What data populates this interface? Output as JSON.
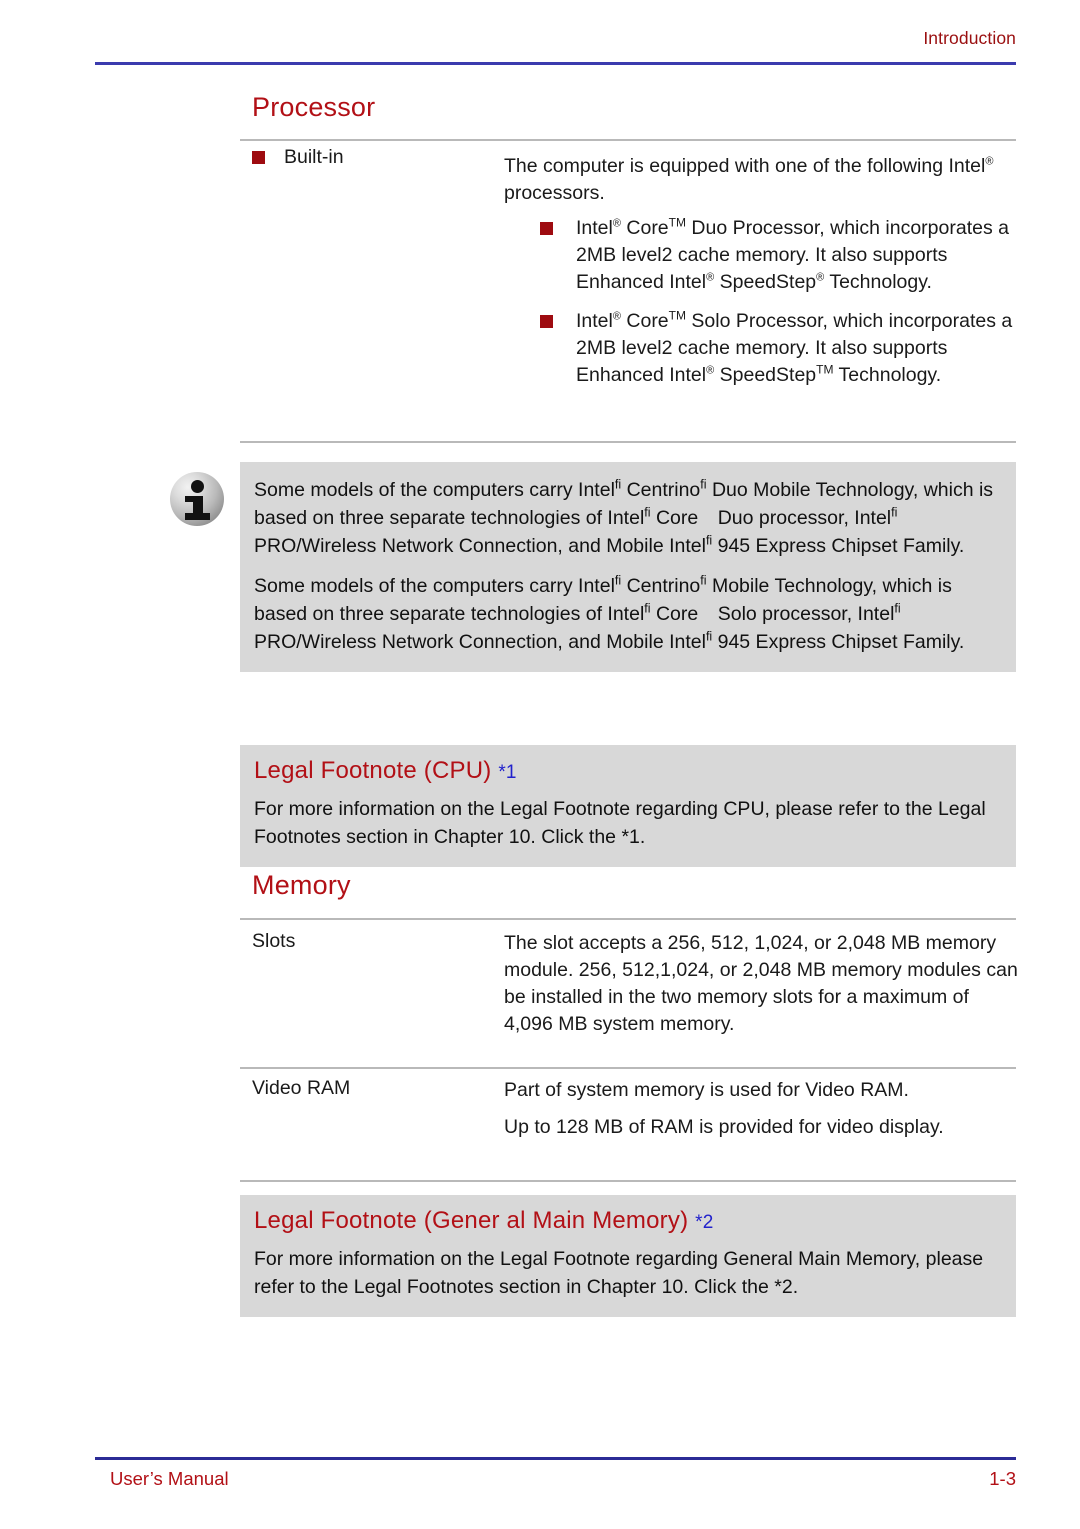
{
  "header": {
    "title": "Introduction"
  },
  "sections": {
    "processor": {
      "heading": "Processor",
      "row_label": "Built-in",
      "intro_line1": "The computer is equipped with one of the",
      "intro_line2_a": "following Intel",
      "intro_line2_reg": "®",
      "intro_line2_b": " processors.",
      "bullets": [
        {
          "brand": "Intel",
          "reg1": "®",
          "core": " Core",
          "tm1": "TM",
          "rest_a": " Duo Processor, which incorporates a 2MB level2 cache memory. It also supports Enhanced Intel",
          "reg2": "®",
          "rest_b": " SpeedStep",
          "mark_end": "®",
          "rest_c": " Technology."
        },
        {
          "brand": "Intel",
          "reg1": "®",
          "core": " Core",
          "tm1": "TM",
          "rest_a": " Solo Processor, which incorporates a 2MB level2 cache memory. It also supports Enhanced Intel",
          "reg2": "®",
          "rest_b": " SpeedStep",
          "mark_end": "TM",
          "rest_c": " Technology."
        }
      ]
    },
    "note": {
      "paragraph1_parts": {
        "p1": "Some models of the computers carry Intel",
        "fi1": "fi",
        "p2": " Centrino",
        "fi2": "fi",
        "p3": " Duo Mobile Technology, which is based on three separate technologies of Intel",
        "fi3": "fi",
        "p4": " Core Duo processor, Intel",
        "fi4": "fi",
        "p5": " PRO/Wireless Network Connection, and Mobile Intel",
        "fi5": "fi",
        "p6": " 945 Express Chipset Family."
      },
      "paragraph2_parts": {
        "p1": "Some models of the computers carry Intel",
        "fi1": "fi",
        "p2": " Centrino",
        "fi2": "fi",
        "p3": " Mobile Technology, which is based on three separate technologies of Intel",
        "fi3": "fi",
        "p4": " Core Solo processor, Intel",
        "fi4": "fi",
        "p5": " PRO/Wireless Network Connection, and Mobile Intel",
        "fi5": "fi",
        "p6": " 945 Express Chipset Family."
      }
    },
    "legal_cpu": {
      "title": "Legal Footnote (CPU)",
      "star": "*1",
      "body": "For more information on the Legal Footnote regarding CPU, please refer to the Legal Footnotes section in Chapter 10. Click the *1."
    },
    "memory": {
      "heading": "Memory",
      "rows": [
        {
          "label": "Slots",
          "paragraphs": [
            "The slot accepts a 256, 512, 1,024, or 2,048 MB memory module. 256, 512,1,024, or 2,048 MB memory modules can be installed in the two memory slots for a maximum of 4,096 MB system memory."
          ]
        },
        {
          "label": "Video RAM",
          "paragraphs": [
            "Part of system memory is used for Video RAM.",
            "Up to 128 MB of RAM is provided for video display."
          ]
        }
      ]
    },
    "legal_memory": {
      "title": "Legal Footnote (Gener  al Main Memory)",
      "star": "*2",
      "body": "For more information on the Legal Footnote regarding General Main Memory, please refer to the Legal Footnotes section in Chapter 10. Click the *2."
    }
  },
  "footer": {
    "left": "User’s Manual",
    "right": "1-3"
  },
  "colors": {
    "heading_red": "#b21016",
    "header_red": "#9a0f10",
    "bullet_red": "#9e0b10",
    "link_blue": "#2222cc",
    "rule_blue": "#3b3bae",
    "footer_rule_blue": "#2b2b96",
    "box_gray": "#d8d8d8",
    "table_rule_gray": "#b9b9b9"
  }
}
